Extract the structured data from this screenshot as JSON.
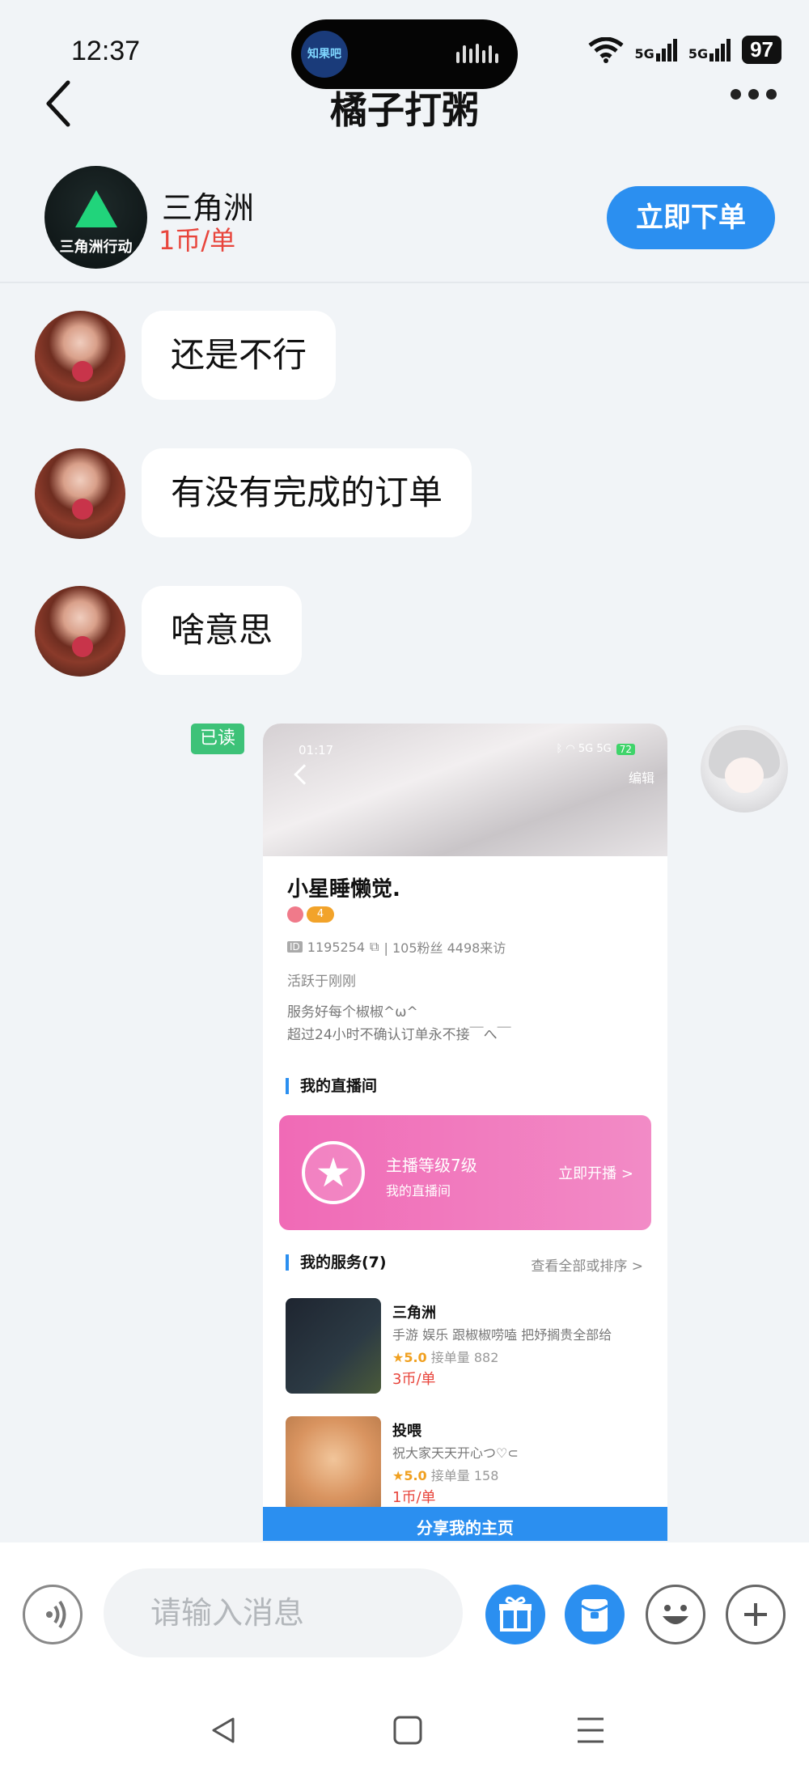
{
  "status_bar": {
    "time": "12:37",
    "island_app": "知果吧",
    "signal_1": "5G",
    "signal_2": "5G",
    "battery": "97"
  },
  "header": {
    "title": "橘子打粥"
  },
  "service": {
    "logo_text": "三角洲行动",
    "name": "三角洲",
    "price": "1币/单",
    "order_button": "立即下单"
  },
  "messages": [
    {
      "from": "other",
      "text": "还是不行"
    },
    {
      "from": "other",
      "text": "有没有完成的订单"
    },
    {
      "from": "other",
      "text": "啥意思"
    }
  ],
  "my_message": {
    "read_status": "已读",
    "image": {
      "status_time": "01:17",
      "status_battery": "72",
      "edit_label": "编辑",
      "username": "小星睡懒觉.",
      "level_badge": "4",
      "id_label": "ID",
      "id_value": "1195254",
      "stats": "| 105粉丝 4498来访",
      "active": "活跃于刚刚",
      "intro_1": "服务好每个椒椒^ω^",
      "intro_2": "超过24小时不确认订单永不接￣へ￣",
      "live_section": "我的直播间",
      "live_level": "主播等级7级",
      "live_room": "我的直播间",
      "live_start": "立即开播 >",
      "services_section": "我的服务(7)",
      "services_all": "查看全部或排序 >",
      "services": [
        {
          "title": "三角洲",
          "desc": "手游 娱乐 跟椒椒唠嗑 把妤搁贵全部给",
          "rating": "★5.0",
          "orders": "接单量 882",
          "price": "3币/单"
        },
        {
          "title": "投喂",
          "desc": "祝大家天天开心つ♡⊂",
          "rating": "★5.0",
          "orders": "接单量 158",
          "price": "1币/单"
        }
      ],
      "share_button": "分享我的主页"
    }
  },
  "input": {
    "placeholder": "请输入消息"
  },
  "colors": {
    "accent": "#2b8ff0",
    "price_red": "#e8453c",
    "read_green": "#3dc278",
    "live_pink": "#f06ab6"
  },
  "icons": [
    "back-icon",
    "more-icon",
    "voice-icon",
    "gift-icon",
    "red-packet-icon",
    "emoji-icon",
    "plus-icon",
    "nav-back-icon",
    "nav-home-icon",
    "nav-menu-icon"
  ]
}
